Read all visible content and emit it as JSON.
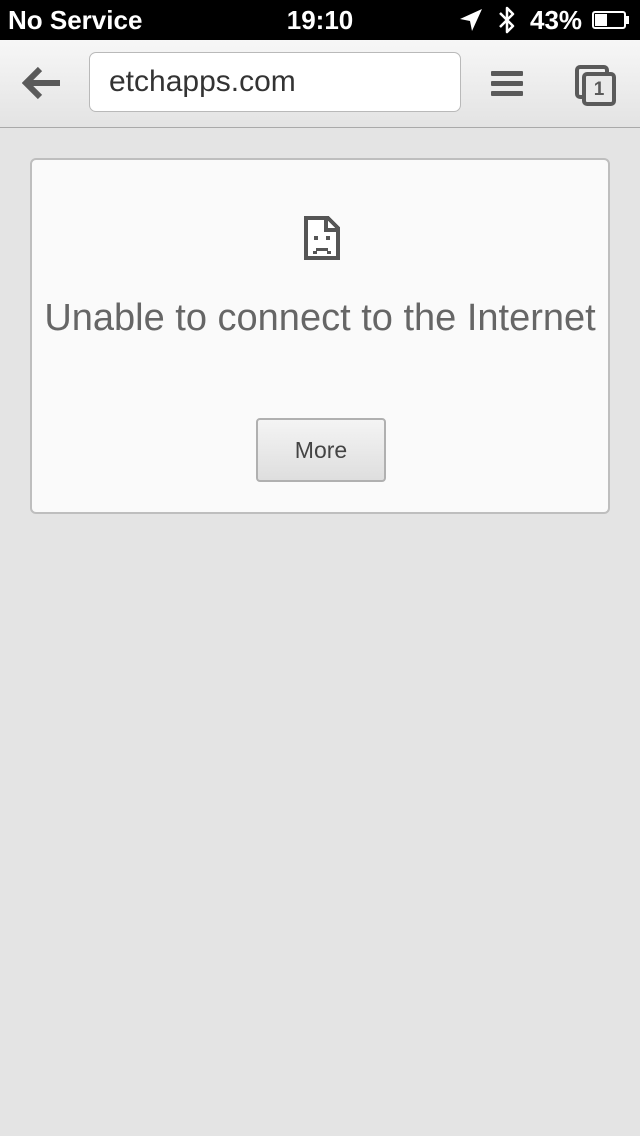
{
  "status_bar": {
    "carrier": "No Service",
    "time": "19:10",
    "battery_percent": "43%",
    "battery_level": 0.43,
    "icons": [
      "location-arrow-icon",
      "bluetooth-icon",
      "battery-icon"
    ]
  },
  "toolbar": {
    "back_icon": "back-arrow-icon",
    "url": "etchapps.com",
    "menu_icon": "hamburger-menu-icon",
    "tab_count": "1"
  },
  "error": {
    "icon": "sad-file-icon",
    "message": "Unable to connect to the Internet",
    "more_label": "More"
  },
  "colors": {
    "page_background": "#e4e4e4",
    "card_background": "#fafafa",
    "text_gray": "#666666",
    "icon_gray": "#5a5a5a"
  }
}
